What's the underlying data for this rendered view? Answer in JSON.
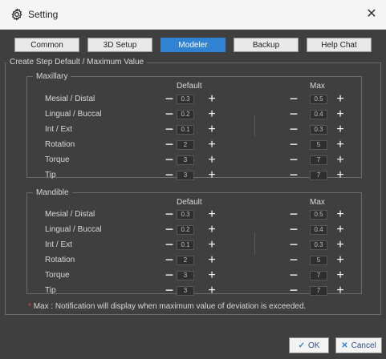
{
  "window": {
    "title": "Setting",
    "close_icon": "close-icon"
  },
  "tabs": [
    "Common",
    "3D Setup",
    "Modeler",
    "Backup",
    "Help Chat"
  ],
  "active_tab": 2,
  "main_group_label": "Create Step Default / Maximum Value",
  "sections": [
    {
      "label": "Maxillary",
      "default_header": "Default",
      "max_header": "Max",
      "rows": [
        {
          "label": "Mesial / Distal",
          "default": "0.3",
          "max": "0.5"
        },
        {
          "label": "Lingual / Buccal",
          "default": "0.2",
          "max": "0.4"
        },
        {
          "label": "Int / Ext",
          "default": "0.1",
          "max": "0.3"
        },
        {
          "label": "Rotation",
          "default": "2",
          "max": "5"
        },
        {
          "label": "Torque",
          "default": "3",
          "max": "7"
        },
        {
          "label": "Tip",
          "default": "3",
          "max": "7"
        }
      ]
    },
    {
      "label": "Mandible",
      "default_header": "Default",
      "max_header": "Max",
      "rows": [
        {
          "label": "Mesial / Distal",
          "default": "0.3",
          "max": "0.5"
        },
        {
          "label": "Lingual / Buccal",
          "default": "0.2",
          "max": "0.4"
        },
        {
          "label": "Int / Ext",
          "default": "0.1",
          "max": "0.3"
        },
        {
          "label": "Rotation",
          "default": "2",
          "max": "5"
        },
        {
          "label": "Torque",
          "default": "3",
          "max": "7"
        },
        {
          "label": "Tip",
          "default": "3",
          "max": "7"
        }
      ]
    }
  ],
  "note": {
    "marker": "*",
    "text": "Max : Notification will display when maximum value of deviation is exceeded."
  },
  "buttons": {
    "ok": "OK",
    "cancel": "Cancel"
  },
  "colors": {
    "accent": "#2f83d2",
    "panel": "#3f3f3f",
    "warning": "#e04747"
  }
}
